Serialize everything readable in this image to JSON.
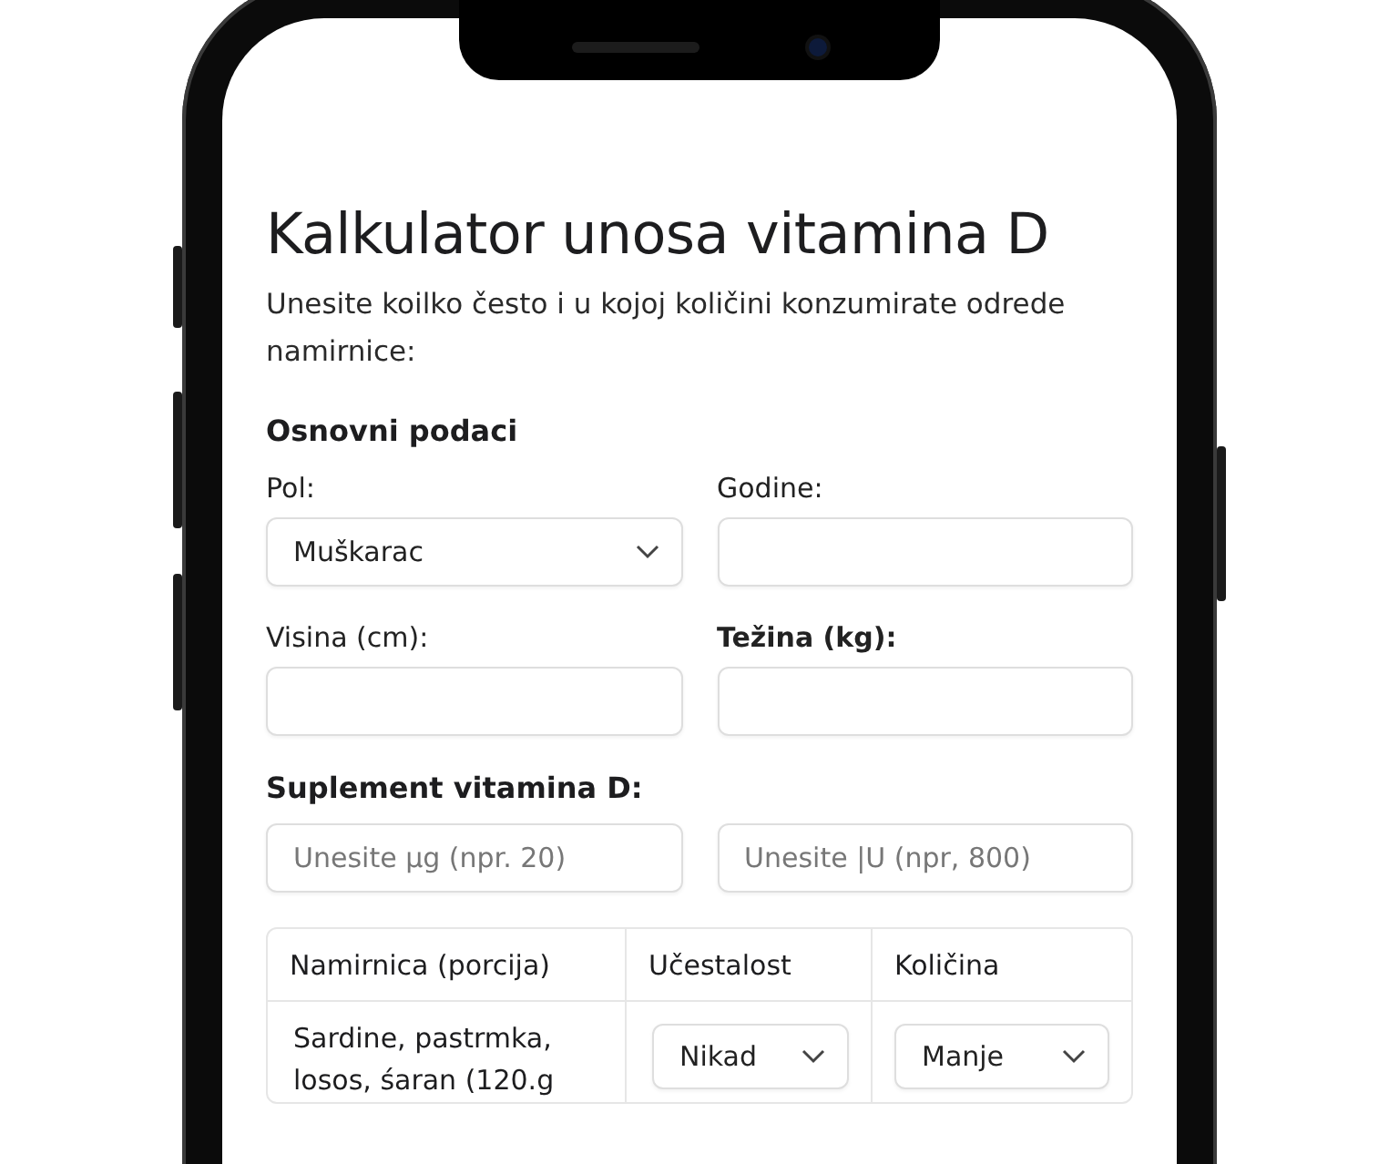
{
  "title": "Kalkulator unosa vitamina D",
  "intro": "Unesite koilko često i u kojoj količini konzumirate odrede namirnice:",
  "basic": {
    "heading": "Osnovni podaci",
    "fields": [
      {
        "label": "Pol:",
        "bold": false,
        "kind": "select",
        "value": "Muškarac"
      },
      {
        "label": "Godine:",
        "bold": false,
        "kind": "input"
      },
      {
        "label": "Visina (cm):",
        "bold": false,
        "kind": "input"
      },
      {
        "label": "Težina (kg):",
        "bold": true,
        "kind": "input"
      }
    ]
  },
  "supplement": {
    "heading": "Suplement vitamina D:",
    "fields": [
      {
        "placeholder": "Unesite µg (npr. 20)"
      },
      {
        "placeholder": "Unesite |U (npr, 800)"
      }
    ]
  },
  "table": {
    "columns": [
      "Namirnica (porcija)",
      "Učestalost",
      "Količina"
    ],
    "rows": [
      {
        "food": "Sardine, pastrmka, losos, śaran (120.g",
        "frequency": "Nikad",
        "amount": "Manje"
      }
    ]
  }
}
